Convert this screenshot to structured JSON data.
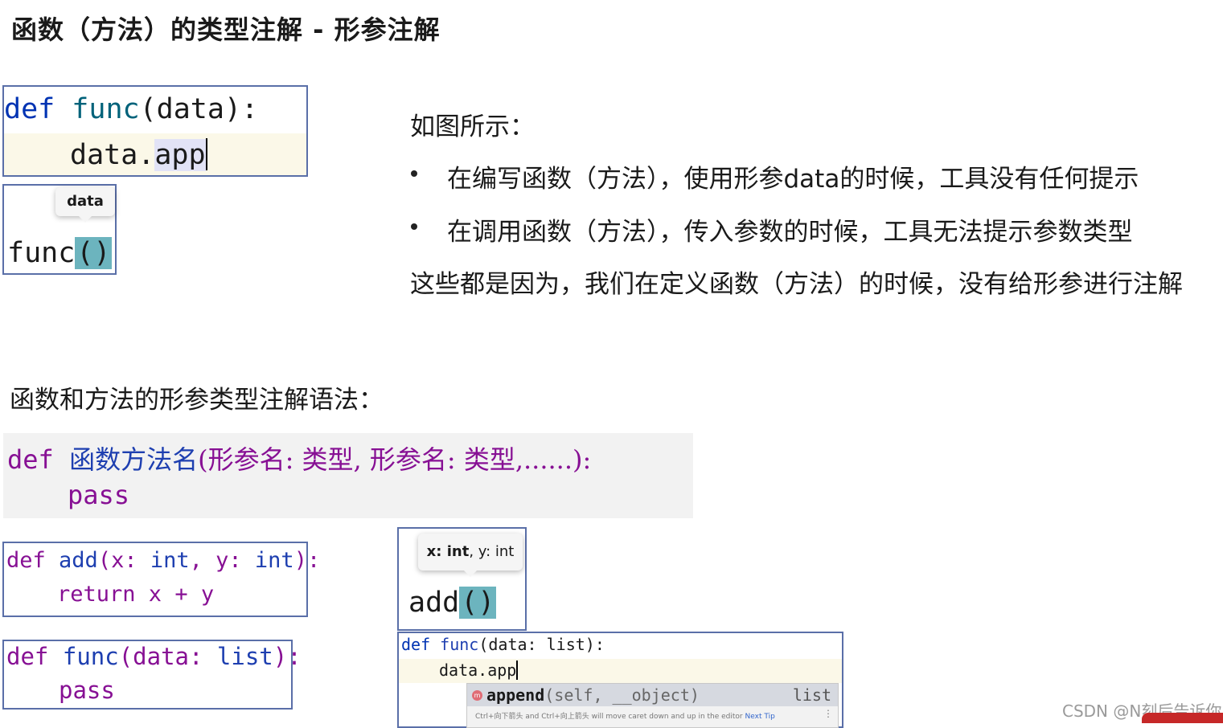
{
  "title": "函数（方法）的类型注解 - 形参注解",
  "box1": {
    "def": "def",
    "func": "func",
    "open": "(data):",
    "var": "data.",
    "attr": "app"
  },
  "box2": {
    "tooltip": "data",
    "func": "func",
    "parens": "()"
  },
  "explanation": {
    "heading": "如图所示：",
    "bullets": [
      "在编写函数（方法），使用形参data的时候，工具没有任何提示",
      "在调用函数（方法），传入参数的时候，工具无法提示参数类型"
    ],
    "conclusion": "这些都是因为，我们在定义函数（方法）的时候，没有给形参进行注解"
  },
  "syntax": {
    "title": "函数和方法的形参类型注解语法：",
    "def": "def",
    "name": "函数方法名",
    "params": "(形参名: 类型, 形参名: 类型,......):",
    "body": "pass"
  },
  "add_box": {
    "def": "def",
    "name": "add",
    "sig_a": "(x: ",
    "int1": "int",
    "sig_b": ", y: ",
    "int2": "int",
    "sig_c": "):",
    "ret": "return",
    "expr": " x + y"
  },
  "func_list_box": {
    "def": "def",
    "name": "func",
    "sig_a": "(data: ",
    "type": "list",
    "sig_c": "):",
    "body": "pass"
  },
  "add_tooltip_box": {
    "tooltip_bold": "x: int",
    "tooltip_rest": ", y: int",
    "call": "add",
    "parens": "()"
  },
  "autocomplete_box": {
    "def": "def",
    "name": "func",
    "sig": "(data: list):",
    "line2": "data.app",
    "method": "append",
    "method_args": "(self, __object)",
    "return_type": "list",
    "icon": "m",
    "hint": "Ctrl+向下箭头 and Ctrl+向上箭头 will move caret down and up in the editor",
    "next_tip": "Next Tip",
    "more": "⋮"
  },
  "watermark": "CSDN @N刻后告诉你"
}
